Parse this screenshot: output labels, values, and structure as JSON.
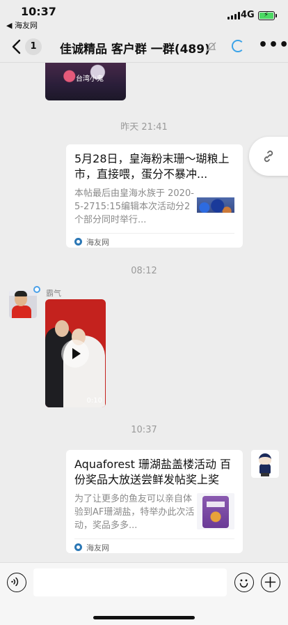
{
  "status_bar": {
    "time": "10:37",
    "back_app": "◀ 海友网",
    "network": "4G"
  },
  "nav": {
    "back_count": "1",
    "title": "佳诚精品 客户群 一群(489)"
  },
  "chat": {
    "top_image_watermark": "台湾小鬼",
    "timestamps": [
      "昨天 21:41",
      "08:12",
      "10:37"
    ],
    "messages": [
      {
        "type": "link-card",
        "title": "5月28日，皇海粉末珊～瑚粮上市，直接喂，蛋分不暴冲...",
        "desc": "本帖最后由皇海水族于 2020-5-2715:15编辑本次活动分2个部分同时举行...",
        "source": "海友网"
      },
      {
        "type": "video",
        "sender": "霸气",
        "duration": "0:10"
      },
      {
        "type": "link-card",
        "title": "Aquaforest 珊湖盐盖楼活动 百份奖品大放送尝鲜发帖奖上奖",
        "desc": "为了让更多的鱼友可以亲自体验到AF珊湖盐，特举办此次活动，奖品多多...",
        "source": "海友网"
      }
    ]
  },
  "icons": {
    "back": "chevron-left-icon",
    "mute": "bell-slash-icon",
    "more": "more-dots-icon",
    "link": "link-icon",
    "voice": "voice-icon",
    "emoji": "emoji-icon",
    "plus": "plus-icon"
  },
  "colors": {
    "background": "#ededed",
    "accent_blue": "#3ba3e8",
    "battery_green": "#4cd964",
    "video_red": "#c4221e"
  }
}
